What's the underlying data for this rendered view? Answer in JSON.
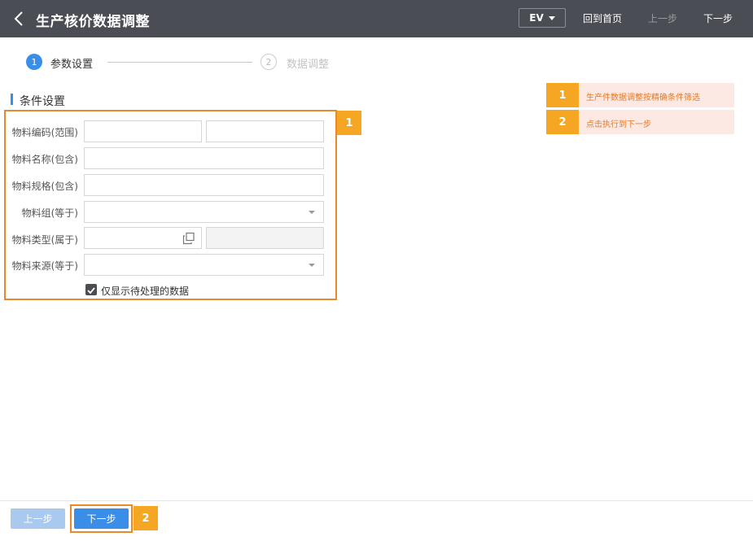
{
  "header": {
    "title": "生产核价数据调整",
    "lang_label": "EV",
    "home_label": "回到首页",
    "prev_label": "上一步",
    "next_label": "下一步"
  },
  "steps": [
    {
      "num": "1",
      "label": "参数设置"
    },
    {
      "num": "2",
      "label": "数据调整"
    }
  ],
  "section": {
    "title": "条件设置"
  },
  "form": {
    "material_code_label": "物料编码(范围)",
    "material_name_label": "物料名称(包含)",
    "material_spec_label": "物料规格(包含)",
    "material_group_label": "物料组(等于)",
    "material_type_label": "物料类型(属于)",
    "material_source_label": "物料来源(等于)",
    "pending_only_label": "仅显示待处理的数据",
    "pending_only_checked": true
  },
  "annotations": {
    "badge1": "1",
    "badge2": "2",
    "notes": [
      {
        "num": "1",
        "text": "生产件数据调整按精确条件筛选"
      },
      {
        "num": "2",
        "text": "点击执行到下一步"
      }
    ]
  },
  "footer": {
    "prev_label": "上一步",
    "next_label": "下一步"
  },
  "colors": {
    "header_bg": "#4a4d54",
    "accent": "#3b8ee8",
    "highlight": "#e8892b",
    "badge": "#f5a623"
  }
}
